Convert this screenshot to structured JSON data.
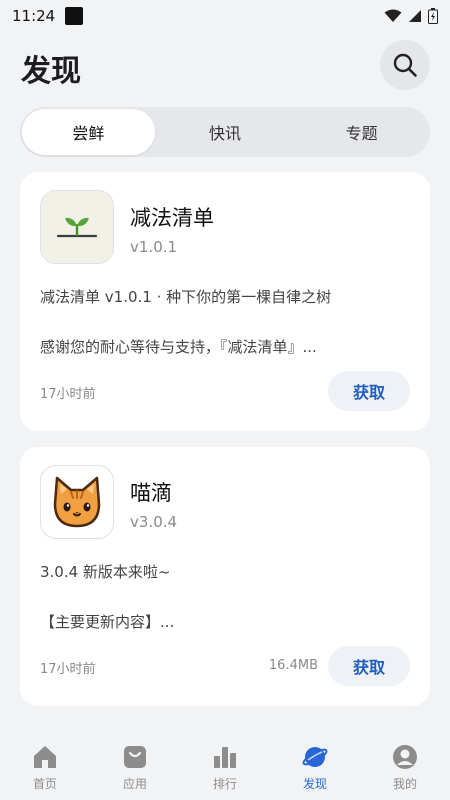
{
  "status_bar": {
    "time": "11:24"
  },
  "header": {
    "title": "发现"
  },
  "tabs": [
    {
      "label": "尝鲜",
      "active": true
    },
    {
      "label": "快讯",
      "active": false
    },
    {
      "label": "专题",
      "active": false
    }
  ],
  "cards": [
    {
      "name": "减法清单",
      "version": "v1.0.1",
      "desc_line1": "减法清单 v1.0.1 · 种下你的第一棵自律之树",
      "desc_line2": "感谢您的耐心等待与支持，『减法清单』...",
      "time": "17小时前",
      "size": "",
      "button": "获取",
      "icon": "sprout-icon"
    },
    {
      "name": "喵滴",
      "version": "v3.0.4",
      "desc_line1": "3.0.4 新版本来啦~",
      "desc_line2": "【主要更新内容】...",
      "time": "17小时前",
      "size": "16.4MB",
      "button": "获取",
      "icon": "cat-icon"
    }
  ],
  "bottom_nav": [
    {
      "label": "首页",
      "icon": "home-icon",
      "active": false
    },
    {
      "label": "应用",
      "icon": "bag-icon",
      "active": false
    },
    {
      "label": "排行",
      "icon": "chart-icon",
      "active": false
    },
    {
      "label": "发现",
      "icon": "planet-icon",
      "active": true
    },
    {
      "label": "我的",
      "icon": "profile-icon",
      "active": false
    }
  ],
  "colors": {
    "accent": "#2866d6",
    "background": "#f2f3f5",
    "button_text": "#1f5fbf"
  }
}
